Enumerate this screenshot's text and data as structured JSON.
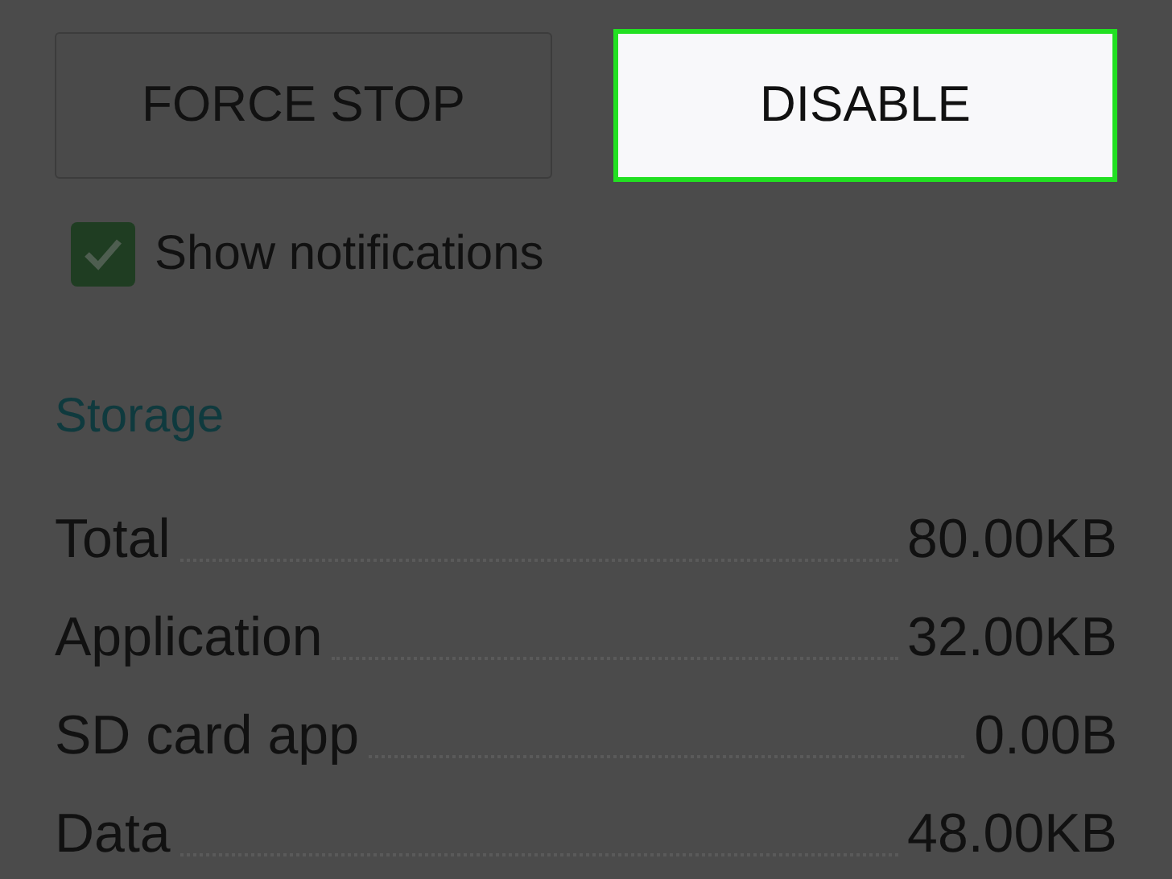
{
  "buttons": [
    {
      "label": "FORCE STOP",
      "highlighted": false
    },
    {
      "label": "DISABLE",
      "highlighted": true
    }
  ],
  "show_notifications": {
    "label": "Show notifications",
    "checked": true
  },
  "storage": {
    "title": "Storage",
    "rows": [
      {
        "label": "Total",
        "value": "80.00KB"
      },
      {
        "label": "Application",
        "value": "32.00KB"
      },
      {
        "label": "SD card app",
        "value": "0.00B"
      },
      {
        "label": "Data",
        "value": "48.00KB"
      }
    ]
  }
}
